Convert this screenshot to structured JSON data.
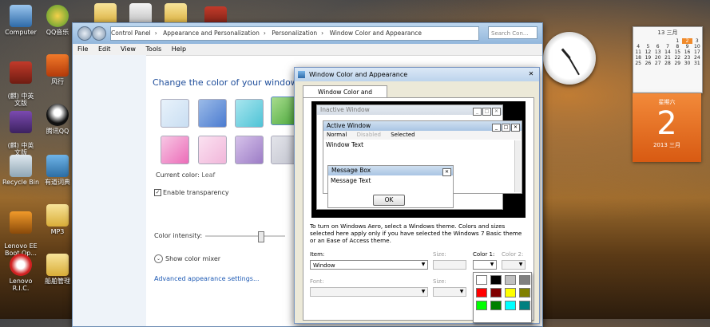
{
  "desktop": {
    "icons": [
      {
        "label": "Computer",
        "pic": "computer-icon"
      },
      {
        "label": "QQ音乐",
        "pic": "qq-music-icon"
      },
      {
        "label": "(麒) 中英\n文版",
        "pic": "dictionary-icon"
      },
      {
        "label": "风行",
        "pic": "funshion-icon"
      },
      {
        "label": "(麒) 中英\n文版",
        "pic": "archive-icon"
      },
      {
        "label": "腾讯QQ",
        "pic": "qq-icon"
      },
      {
        "label": "Recycle Bin",
        "pic": "recycle-bin-icon"
      },
      {
        "label": "有道词典",
        "pic": "youdao-icon"
      },
      {
        "label": "Lenovo EE\nBoot Op...",
        "pic": "lenovo-icon"
      },
      {
        "label": "MP3",
        "pic": "mp3-folder-icon"
      },
      {
        "label": "Lenovo R.I.C.",
        "pic": "robot-icon"
      },
      {
        "label": "船舶管理",
        "pic": "folder-icon"
      }
    ]
  },
  "calendar": {
    "header": "13 三月",
    "weekday": "星期六",
    "day": "2",
    "year_month": "2013 三月",
    "rows": [
      [
        "",
        "",
        "",
        "",
        "1",
        "2",
        "3"
      ],
      [
        "4",
        "5",
        "6",
        "7",
        "8",
        "9",
        "10"
      ],
      [
        "11",
        "12",
        "13",
        "14",
        "15",
        "16",
        "17"
      ],
      [
        "18",
        "19",
        "20",
        "21",
        "22",
        "23",
        "24"
      ],
      [
        "25",
        "26",
        "27",
        "28",
        "29",
        "30",
        "31"
      ]
    ]
  },
  "control_panel": {
    "breadcrumb": [
      "Control Panel",
      "Appearance and Personalization",
      "Personalization",
      "Window Color and Appearance"
    ],
    "search_placeholder": "Search Con...",
    "menu": [
      "File",
      "Edit",
      "View",
      "Tools",
      "Help"
    ],
    "heading": "Change the color of your window borde",
    "current_color_label": "Current color:",
    "current_color_value": "Leaf",
    "enable_transparency": "Enable transparency",
    "color_intensity": "Color intensity:",
    "show_color_mixer": "Show color mixer",
    "advanced_link": "Advanced appearance settings...",
    "swatches": [
      {
        "color_a": "#e8f2fb",
        "color_b": "#c9def2"
      },
      {
        "color_a": "#9bbbe8",
        "color_b": "#4b7bd0"
      },
      {
        "color_a": "#a9e6ef",
        "color_b": "#4ec3d6"
      },
      {
        "color_a": "#a8dc8e",
        "color_b": "#4aa83a"
      },
      {
        "color_a": "#f7c7e4",
        "color_b": "#ec6cb8"
      },
      {
        "color_a": "#fbe2f1",
        "color_b": "#f1b6da"
      },
      {
        "color_a": "#d6c2ea",
        "color_b": "#9c7cc6"
      },
      {
        "color_a": "#e3e4ea",
        "color_b": "#c2c4cf"
      }
    ]
  },
  "dialog": {
    "title": "Window Color and Appearance",
    "tab": "Window Color and Appearance",
    "preview": {
      "inactive_window": "Inactive Window",
      "active_window": "Active Window",
      "menu_normal": "Normal",
      "menu_disabled": "Disabled",
      "menu_selected": "Selected",
      "window_text": "Window Text",
      "message_box": "Message Box",
      "message_text": "Message Text",
      "ok": "OK"
    },
    "info": "To turn on Windows Aero, select a Windows theme.  Colors and sizes selected here apply only if you have selected the Windows 7 Basic theme or an Ease of Access theme.",
    "item_label": "Item:",
    "item_value": "Window",
    "size_label": "Size:",
    "color1_label": "Color 1:",
    "color2_label": "Color 2:",
    "font_label": "Font:",
    "font_size_label": "Size:",
    "palette": [
      "#ffffff",
      "#000000",
      "#c0c0c0",
      "#808080",
      "#ff0000",
      "#800000",
      "#ffff00",
      "#808000",
      "#00ff00",
      "#008000",
      "#00ffff",
      "#008080"
    ]
  }
}
